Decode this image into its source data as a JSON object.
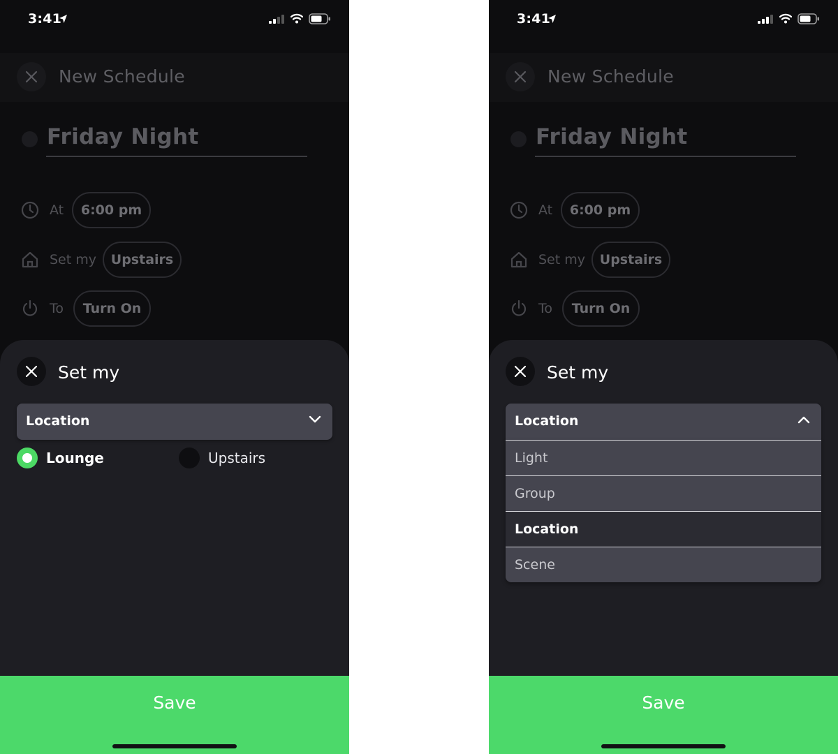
{
  "status_bar": {
    "time": "3:41"
  },
  "header": {
    "title": "New Schedule"
  },
  "schedule": {
    "name": "Friday Night"
  },
  "rules": [
    {
      "icon": "clock-icon",
      "label": "At",
      "value": "6:00 pm"
    },
    {
      "icon": "home-icon",
      "label": "Set my",
      "value": "Upstairs"
    },
    {
      "icon": "power-icon",
      "label": "To",
      "value": "Turn On"
    }
  ],
  "sheet": {
    "title": "Set my",
    "dropdown_value": "Location",
    "radio_options": [
      {
        "label": "Lounge",
        "selected": true
      },
      {
        "label": "Upstairs",
        "selected": false
      }
    ],
    "dropdown_options": [
      {
        "label": "Light",
        "selected": false
      },
      {
        "label": "Group",
        "selected": false
      },
      {
        "label": "Location",
        "selected": true
      },
      {
        "label": "Scene",
        "selected": false
      }
    ]
  },
  "save_label": "Save",
  "colors": {
    "accent": "#4cd964",
    "save_bg": "#4cd96a",
    "sheet_bg": "#1e1e23",
    "dropdown_bg": "#45454f"
  }
}
